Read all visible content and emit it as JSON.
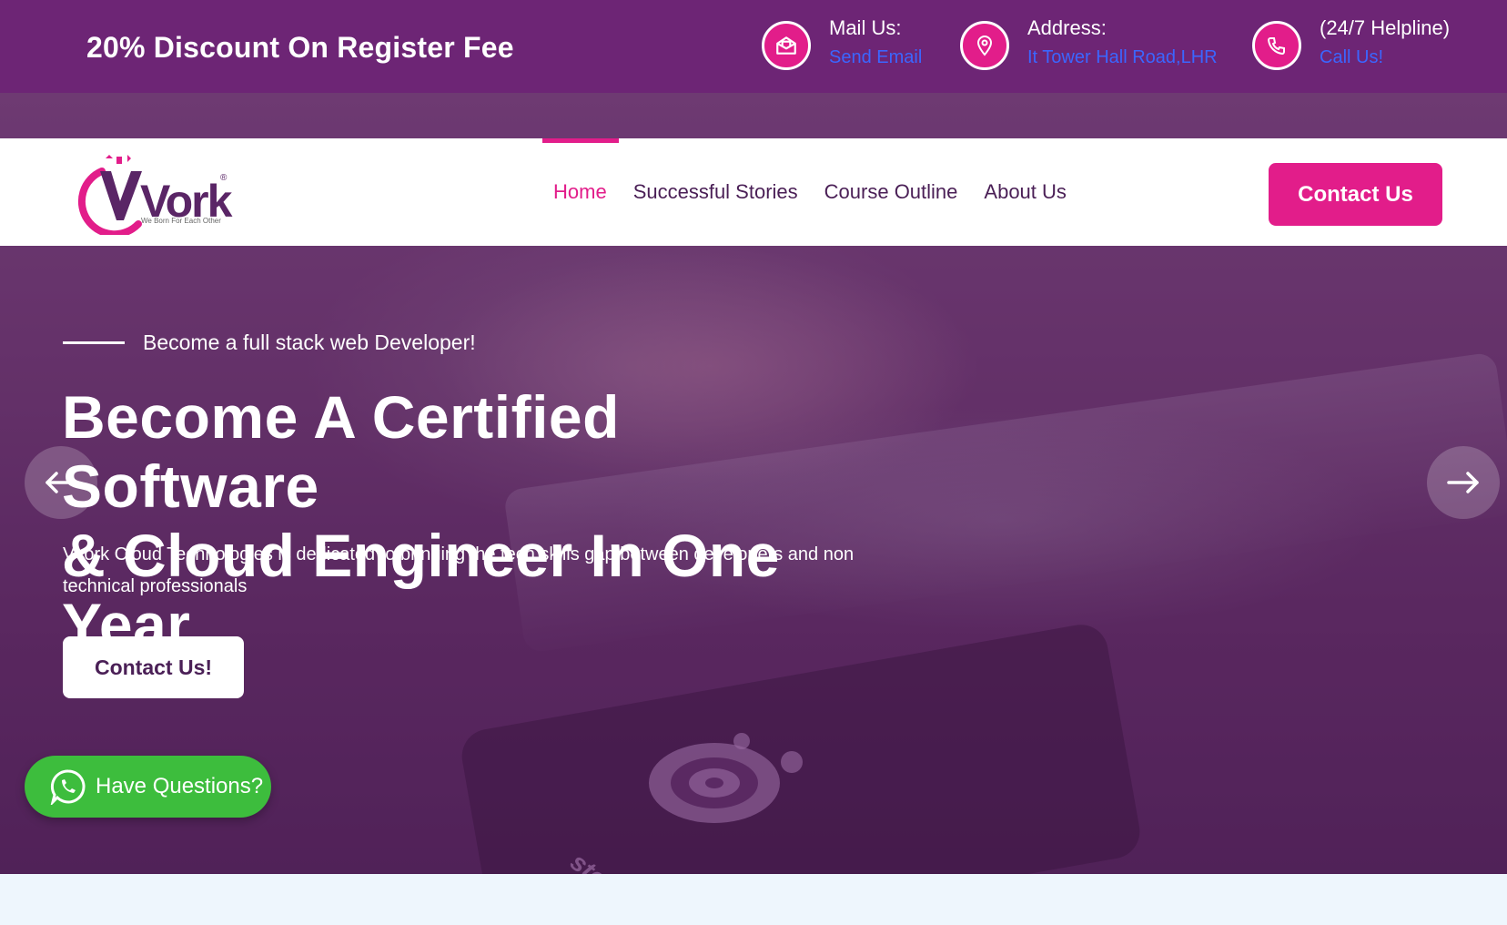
{
  "topbar": {
    "promo": "20% Discount On Register Fee",
    "mail": {
      "label": "Mail Us:",
      "value": "Send Email",
      "icon": "mail-open-icon"
    },
    "address": {
      "label": "Address:",
      "value": "It Tower Hall Road,LHR",
      "icon": "map-pin-icon"
    },
    "helpline": {
      "label": "(24/7 Helpline)",
      "value": "Call Us!",
      "icon": "phone-icon"
    }
  },
  "logo": {
    "text": "Vork",
    "registered": "®",
    "tagline": "We Born For Each Other"
  },
  "nav": {
    "items": [
      {
        "label": "Home",
        "active": true
      },
      {
        "label": "Successful Stories",
        "active": false
      },
      {
        "label": "Course Outline",
        "active": false
      },
      {
        "label": "About Us",
        "active": false
      }
    ],
    "contact_button": "Contact Us"
  },
  "hero": {
    "kicker": "Become a full stack web Developer!",
    "headline_line1": "Become A Certified Software",
    "headline_line2": "& Cloud Engineer In One Year.",
    "subtext": "Vvork Cloud Technologies is dedicated to bringing the tech skills gap between developers and non technical professionals",
    "button": "Contact Us!",
    "background_brand": "steelseries"
  },
  "whatsapp": {
    "label": "Have Questions?",
    "icon": "whatsapp-icon"
  },
  "colors": {
    "topbar": "#6d2575",
    "accent": "#e21d8a",
    "link": "#3b66ff",
    "nav_text": "#4a1f56",
    "whatsapp": "#3dbd3d"
  }
}
